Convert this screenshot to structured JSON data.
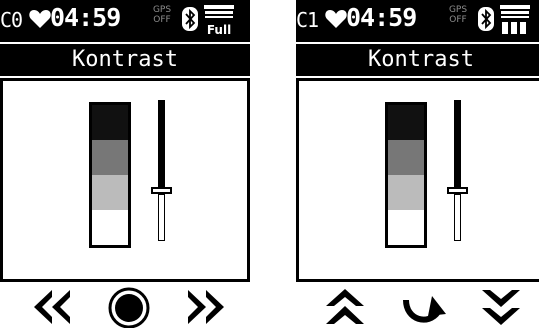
{
  "colors": {
    "background": "#ffffff",
    "bar": "#000000",
    "text": "#ffffff",
    "gps_dim": "#8c8c8c",
    "swatch_steps": [
      "#111111",
      "#777777",
      "#bbbbbb",
      "#ffffff"
    ]
  },
  "screens": [
    {
      "mode": "C0",
      "time": "04:59",
      "gps_top": "GPS",
      "gps_bottom": "OFF",
      "title": "Kontrast",
      "slider_level": 0.33,
      "battery_text": "Full",
      "softkeys": [
        {
          "icon": "rewind-icon"
        },
        {
          "icon": "circle-icon"
        },
        {
          "icon": "fast-forward-icon"
        }
      ]
    },
    {
      "mode": "C1",
      "time": "04:59",
      "gps_top": "GPS",
      "gps_bottom": "OFF",
      "title": "Kontrast",
      "slider_level": 0.33,
      "softkeys": [
        {
          "icon": "double-up-icon"
        },
        {
          "icon": "curved-return-icon"
        },
        {
          "icon": "double-down-icon"
        }
      ]
    }
  ]
}
